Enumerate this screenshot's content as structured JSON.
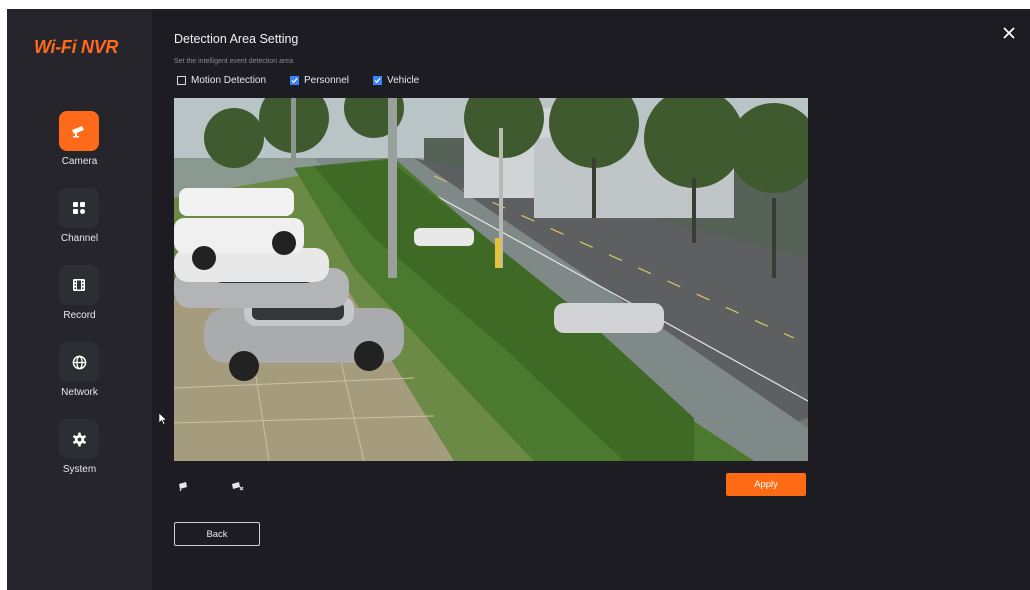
{
  "sidebar": {
    "brand": "Wi-Fi NVR",
    "items": [
      {
        "label": "Camera",
        "icon": "camera-icon",
        "active": true
      },
      {
        "label": "Channel",
        "icon": "channel-grid-icon",
        "active": false
      },
      {
        "label": "Record",
        "icon": "film-icon",
        "active": false
      },
      {
        "label": "Network",
        "icon": "globe-icon",
        "active": false
      },
      {
        "label": "System",
        "icon": "gear-icon",
        "active": false
      }
    ]
  },
  "header": {
    "title": "Detection Area Setting",
    "subtitle": "Set the intelligent event detection area"
  },
  "options": [
    {
      "label": "Motion Detection",
      "checked": false
    },
    {
      "label": "Personnel",
      "checked": true
    },
    {
      "label": "Vehicle",
      "checked": true
    }
  ],
  "tools": {
    "draw_icon": "draw-area-icon",
    "clear_icon": "clear-area-icon"
  },
  "buttons": {
    "apply": "Apply",
    "back": "Back"
  },
  "colors": {
    "accent": "#ff6a1a",
    "checkbox": "#3b82f6",
    "background": "#1c1c22",
    "sidebar": "#25252b"
  }
}
